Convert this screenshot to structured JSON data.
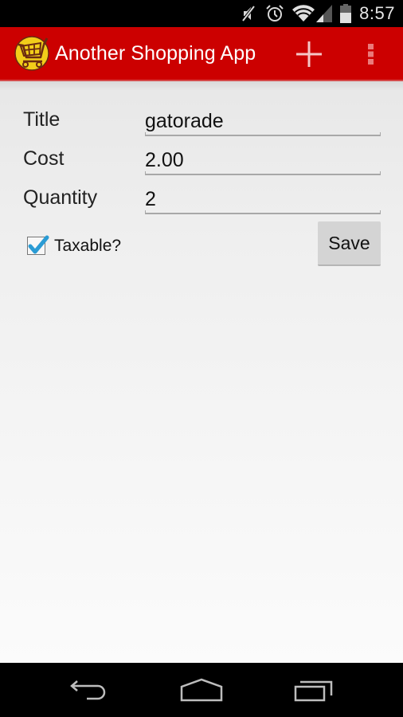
{
  "status_bar": {
    "time": "8:57",
    "icons": [
      "muted-icon",
      "alarm-icon",
      "wifi-icon",
      "cell-signal-icon",
      "battery-icon"
    ]
  },
  "action_bar": {
    "title": "Another Shopping App",
    "logo_icon": "shopping-cart-icon",
    "actions": [
      {
        "name": "add",
        "icon": "plus-icon"
      },
      {
        "name": "overflow-menu",
        "icon": "more-vertical-icon"
      }
    ],
    "color": "#cc0000"
  },
  "form": {
    "fields": [
      {
        "label": "Title",
        "value": "gatorade"
      },
      {
        "label": "Cost",
        "value": "2.00"
      },
      {
        "label": "Quantity",
        "value": "2"
      }
    ],
    "taxable": {
      "label": "Taxable?",
      "checked": true,
      "check_color": "#2a9bd4"
    },
    "save_label": "Save"
  },
  "nav_bar": {
    "buttons": [
      {
        "name": "back",
        "icon": "back-icon"
      },
      {
        "name": "home",
        "icon": "home-icon"
      },
      {
        "name": "recents",
        "icon": "recents-icon"
      }
    ]
  }
}
